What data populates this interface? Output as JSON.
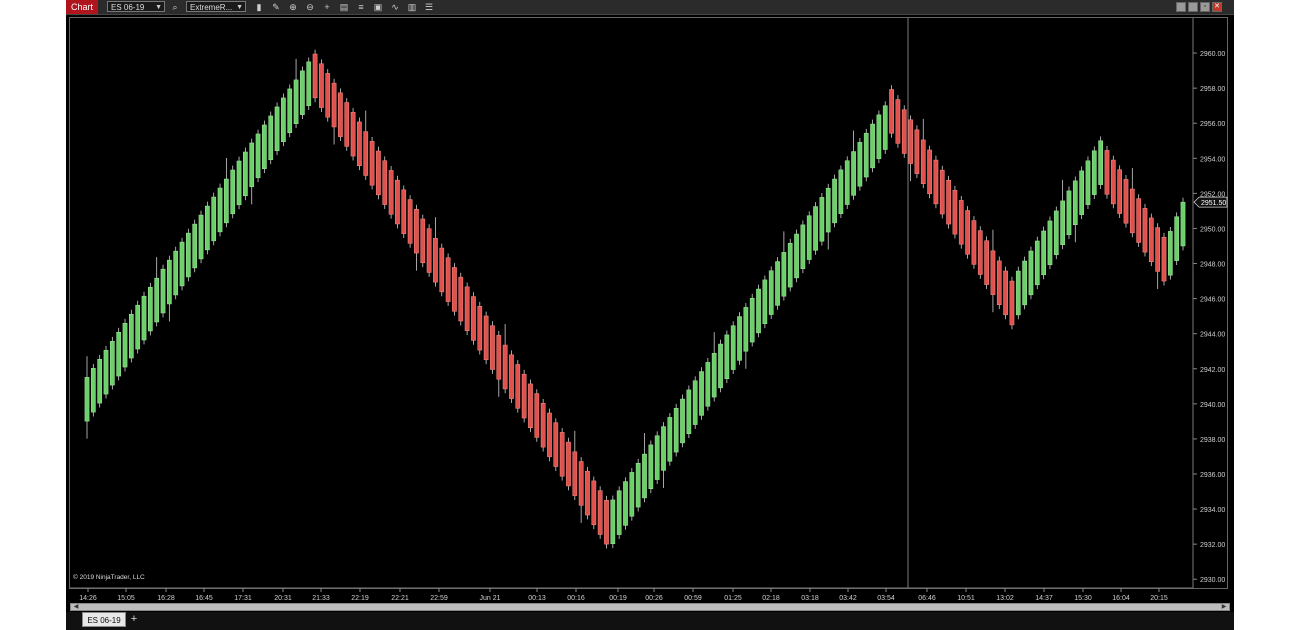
{
  "toolbar": {
    "chart_label": "Chart",
    "instrument_value": "ES 06-19",
    "bartype_value": "ExtremeR...",
    "icons": [
      "search-icon",
      "bar-type-icon",
      "draw-pencil-icon",
      "zoom-in-icon",
      "zoom-out-icon",
      "crosshair-icon",
      "data-box-icon",
      "properties-icon",
      "strategies-icon",
      "indicators-icon",
      "templates-icon"
    ],
    "window_icons": [
      "minimize-icon",
      "restore-icon",
      "maximize-icon",
      "close-icon"
    ]
  },
  "copyright": "© 2019 NinjaTrader, LLC",
  "price_marker": "2951.50",
  "tabs": {
    "instrument_tab": "ES 06-19",
    "add_tab": "+"
  },
  "colors": {
    "up": "#6ccf6a",
    "down": "#e0524d",
    "background": "#000000",
    "axis_text": "#d0d0d0",
    "crosshair": "#9a9a9a"
  },
  "chart_data": {
    "type": "candlestick",
    "title": "",
    "instrument": "ES 06-19",
    "ylim": [
      2929.5,
      2962.0
    ],
    "y_ticks": [
      "2930.00",
      "2932.00",
      "2934.00",
      "2936.00",
      "2938.00",
      "2940.00",
      "2942.00",
      "2944.00",
      "2946.00",
      "2948.00",
      "2950.00",
      "2952.00",
      "2954.00",
      "2956.00",
      "2958.00",
      "2960.00"
    ],
    "x_tick_labels": [
      "14:26",
      "15:05",
      "16:28",
      "16:45",
      "17:31",
      "20:31",
      "21:33",
      "22:19",
      "22:21",
      "22:59",
      "Jun 21",
      "00:13",
      "00:16",
      "00:19",
      "00:26",
      "00:59",
      "01:25",
      "02:18",
      "03:18",
      "03:42",
      "03:54",
      "06:46",
      "10:51",
      "13:02",
      "14:37",
      "15:30",
      "16:04",
      "20:15"
    ],
    "legs": [
      {
        "direction": "up",
        "bars": 36,
        "start": 2941.0,
        "end": 2959.5
      },
      {
        "direction": "down",
        "bars": 47,
        "start": 2958.0,
        "end": 2932.0
      },
      {
        "direction": "up",
        "bars": 44,
        "start": 2934.0,
        "end": 2957.0
      },
      {
        "direction": "down",
        "bars": 20,
        "start": 2956.0,
        "end": 2944.5
      },
      {
        "direction": "up",
        "bars": 14,
        "start": 2947.0,
        "end": 2955.0
      },
      {
        "direction": "down",
        "bars": 10,
        "start": 2952.5,
        "end": 2947.0
      },
      {
        "direction": "up",
        "bars": 3,
        "start": 2949.0,
        "end": 2951.5
      }
    ],
    "last_price": 2951.5,
    "crosshair_visible": true,
    "grid": false
  }
}
